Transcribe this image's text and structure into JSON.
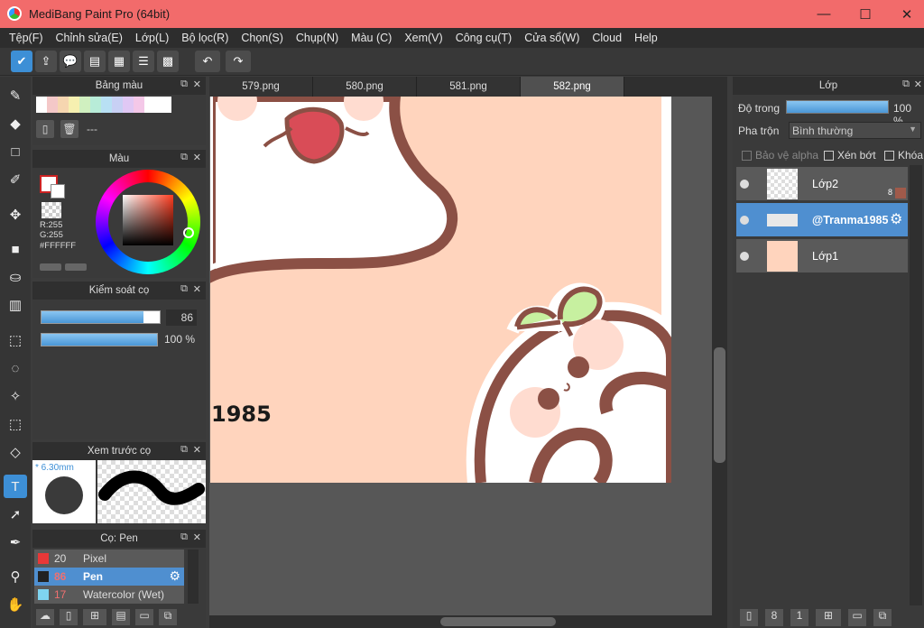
{
  "window": {
    "title": "MediBang Paint Pro (64bit)",
    "minimize": "—",
    "maximize": "☐",
    "close": "✕"
  },
  "menu": [
    "Tệp(F)",
    "Chỉnh sửa(E)",
    "Lớp(L)",
    "Bộ lọc(R)",
    "Chọn(S)",
    "Chụp(N)",
    "Màu (C)",
    "Xem(V)",
    "Công cụ(T)",
    "Cửa sổ(W)",
    "Cloud",
    "Help"
  ],
  "tabs": [
    "579.png",
    "580.png",
    "581.png",
    "582.png"
  ],
  "palette": {
    "title": "Bảng màu",
    "name": "---"
  },
  "color": {
    "title": "Màu",
    "r": "R:255",
    "g": "G:255",
    "hex": "#FFFFFF"
  },
  "brush_control": {
    "title": "Kiểm soát cọ",
    "size": "86",
    "opacity": "100 %",
    "size_fraction": 0.86,
    "opacity_fraction": 1.0
  },
  "brush_preview": {
    "title": "Xem trước cọ",
    "size": "* 6.30mm"
  },
  "brush_list": {
    "title": "Cọ: Pen",
    "items": [
      {
        "size": "20",
        "name": "Pixel",
        "color": "#e83838"
      },
      {
        "size": "86",
        "name": "Pen",
        "color": "#222222"
      },
      {
        "size": "17",
        "name": "Watercolor (Wet)",
        "color": "#7fd4f0"
      }
    ]
  },
  "layers": {
    "title": "Lớp",
    "opacity_label": "Độ trong",
    "opacity_value": "100 %",
    "opacity_fraction": 1.0,
    "blend_label": "Pha trộn",
    "blend_value": "Bình thường",
    "protect_alpha": "Bảo vệ alpha",
    "clipping": "Xén bớt",
    "lock": "Khóa",
    "items": [
      {
        "name": "Lớp2",
        "badge": "8"
      },
      {
        "name": "@Tranma1985",
        "badge": ""
      },
      {
        "name": "Lớp1",
        "badge": ""
      }
    ]
  },
  "canvas_text": "1985"
}
